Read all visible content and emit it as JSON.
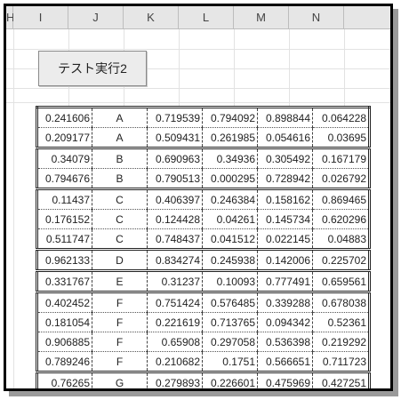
{
  "columns": [
    "H",
    "I",
    "J",
    "K",
    "L",
    "M",
    "N"
  ],
  "button_label": "テスト実行2",
  "rows": [
    [
      "0.241606",
      "A",
      "0.719539",
      "0.794092",
      "0.898844",
      "0.064228"
    ],
    [
      "0.209177",
      "A",
      "0.509431",
      "0.261985",
      "0.054616",
      "0.03695"
    ],
    [
      "0.34079",
      "B",
      "0.690963",
      "0.34936",
      "0.305492",
      "0.167179"
    ],
    [
      "0.794676",
      "B",
      "0.790513",
      "0.000295",
      "0.728942",
      "0.026792"
    ],
    [
      "0.11437",
      "C",
      "0.406397",
      "0.246384",
      "0.158162",
      "0.869465"
    ],
    [
      "0.176152",
      "C",
      "0.124428",
      "0.04261",
      "0.145734",
      "0.620296"
    ],
    [
      "0.511747",
      "C",
      "0.748437",
      "0.041512",
      "0.022145",
      "0.04883"
    ],
    [
      "0.962133",
      "D",
      "0.834274",
      "0.245938",
      "0.142006",
      "0.225702"
    ],
    [
      "0.331767",
      "E",
      "0.31237",
      "0.10093",
      "0.777491",
      "0.659561"
    ],
    [
      "0.402452",
      "F",
      "0.751424",
      "0.576485",
      "0.339288",
      "0.678038"
    ],
    [
      "0.181054",
      "F",
      "0.221619",
      "0.713765",
      "0.094342",
      "0.52361"
    ],
    [
      "0.906885",
      "F",
      "0.65908",
      "0.297058",
      "0.536398",
      "0.219292"
    ],
    [
      "0.789246",
      "F",
      "0.210682",
      "0.1751",
      "0.566651",
      "0.711723"
    ],
    [
      "0.76265",
      "G",
      "0.279893",
      "0.226601",
      "0.475969",
      "0.427251"
    ]
  ]
}
